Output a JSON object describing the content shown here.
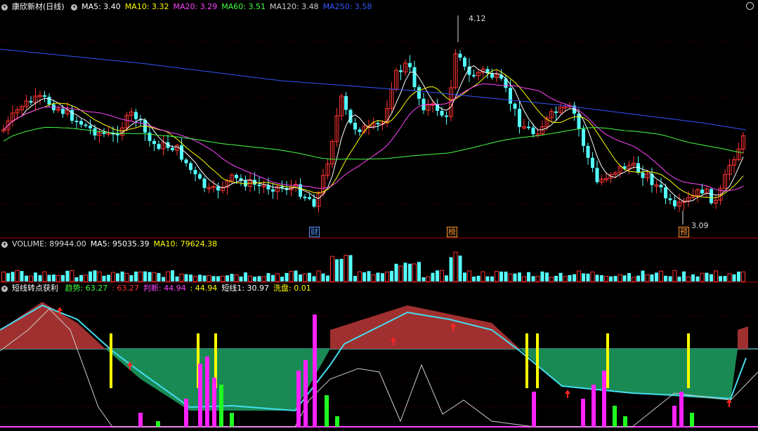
{
  "price_panel": {
    "stock": "康欣新材(日线)",
    "ma": [
      {
        "label": "MA5: 3.40",
        "color": "#ffffff"
      },
      {
        "label": "MA10: 3.32",
        "color": "#ffff00"
      },
      {
        "label": "MA20: 3.29",
        "color": "#ff44ff"
      },
      {
        "label": "MA60: 3.51",
        "color": "#44ff44"
      },
      {
        "label": "MA120: 3.48",
        "color": "#cccccc"
      },
      {
        "label": "MA250: 3.58",
        "color": "#3355ff"
      }
    ],
    "high_label": "4.12",
    "low_label": "3.09",
    "events": [
      {
        "text": "财",
        "color": "#5599ff"
      },
      {
        "text": "榜",
        "color": "#ff9933"
      },
      {
        "text": "预",
        "color": "#ff9933"
      }
    ]
  },
  "volume_panel": {
    "items": [
      {
        "label": "VOLUME: 89944.00",
        "color": "#dddddd"
      },
      {
        "label": "MA5: 95035.39",
        "color": "#ffffff"
      },
      {
        "label": "MA10: 79624.38",
        "color": "#ffff00"
      }
    ]
  },
  "indicator_panel": {
    "name": "短线转点获利",
    "items": [
      {
        "label": "趋势: 63.27",
        "color": "#44ff44"
      },
      {
        "label": ": 63.27",
        "color": "#ff3333"
      },
      {
        "label": "判断: 44.94",
        "color": "#ff44ff"
      },
      {
        "label": ": 44.94",
        "color": "#ffff00"
      },
      {
        "label": "短线1: 30.97",
        "color": "#ffffff"
      },
      {
        "label": "洗盘: 0.01",
        "color": "#ffff00"
      }
    ]
  },
  "colors": {
    "up": "#ff3333",
    "down": "#54ffff",
    "ma250": "#3355ff",
    "ma60": "#44ff44",
    "ma20": "#ff44ff",
    "ma10": "#ffff00",
    "ma5": "#ffffff",
    "grid": "#6a0000"
  }
}
